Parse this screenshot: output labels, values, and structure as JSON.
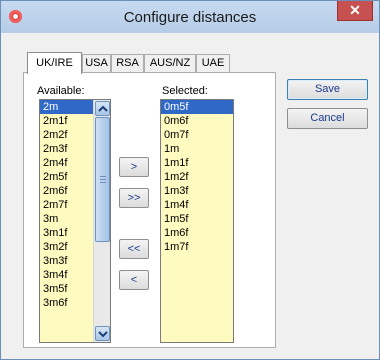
{
  "window": {
    "title": "Configure distances",
    "close_label": "✕"
  },
  "tabs": [
    {
      "label": "UK/IRE"
    },
    {
      "label": "USA"
    },
    {
      "label": "RSA"
    },
    {
      "label": "AUS/NZ"
    },
    {
      "label": "UAE"
    }
  ],
  "available": {
    "label": "Available:",
    "items": [
      "2m",
      "2m1f",
      "2m2f",
      "2m3f",
      "2m4f",
      "2m5f",
      "2m6f",
      "2m7f",
      "3m",
      "3m1f",
      "3m2f",
      "3m3f",
      "3m4f",
      "3m5f",
      "3m6f"
    ],
    "selected_index": 0
  },
  "selected": {
    "label": "Selected:",
    "items": [
      "0m5f",
      "0m6f",
      "0m7f",
      "1m",
      "1m1f",
      "1m2f",
      "1m3f",
      "1m4f",
      "1m5f",
      "1m6f",
      "1m7f"
    ],
    "selected_index": 0
  },
  "move_buttons": {
    "add": ">",
    "add_all": ">>",
    "remove_all": "<<",
    "remove": "<"
  },
  "actions": {
    "save": "Save",
    "cancel": "Cancel"
  },
  "colors": {
    "listbox_bg": "#fefac0",
    "selection": "#3068c8",
    "close": "#c75050"
  }
}
